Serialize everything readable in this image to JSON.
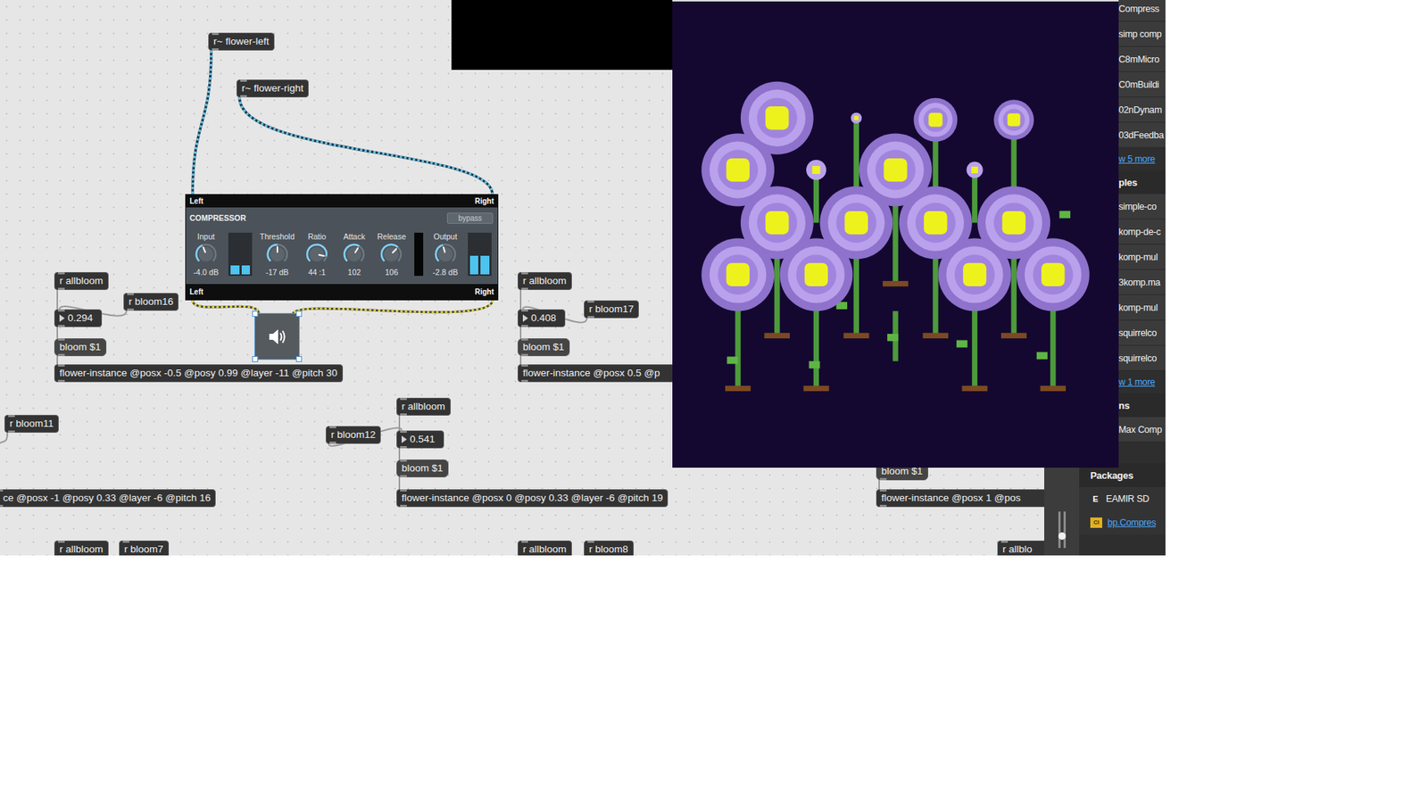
{
  "patcher": {
    "objects": [
      {
        "text": "r~ flower-left",
        "kind": "object"
      },
      {
        "text": "r~ flower-right",
        "kind": "object"
      },
      {
        "text": "r allbloom",
        "kind": "object"
      },
      {
        "text": "r bloom16",
        "kind": "object"
      },
      {
        "text": "0.294",
        "kind": "number"
      },
      {
        "text": "bloom $1",
        "kind": "message"
      },
      {
        "text": "flower-instance @posx -0.5 @posy 0.99 @layer -11 @pitch 30",
        "kind": "object"
      },
      {
        "text": "r allbloom",
        "kind": "object"
      },
      {
        "text": "r bloom17",
        "kind": "object"
      },
      {
        "text": "0.408",
        "kind": "number"
      },
      {
        "text": "bloom $1",
        "kind": "message"
      },
      {
        "text": "flower-instance @posx 0.5 @p",
        "kind": "object"
      },
      {
        "text": "r bloom11",
        "kind": "object"
      },
      {
        "text": "ce @posx -1 @posy 0.33 @layer -6 @pitch 16",
        "kind": "object"
      },
      {
        "text": "r allbloom",
        "kind": "object"
      },
      {
        "text": "r bloom12",
        "kind": "object"
      },
      {
        "text": "0.541",
        "kind": "number"
      },
      {
        "text": "bloom $1",
        "kind": "message"
      },
      {
        "text": "flower-instance @posx 0 @posy 0.33 @layer -6 @pitch 19",
        "kind": "object"
      },
      {
        "text": "bloom $1",
        "kind": "message"
      },
      {
        "text": "flower-instance @posx 1 @pos",
        "kind": "object"
      },
      {
        "text": "r allbloom",
        "kind": "object"
      },
      {
        "text": "r bloom7",
        "kind": "object"
      },
      {
        "text": "r allbloom",
        "kind": "object"
      },
      {
        "text": "r bloom8",
        "kind": "object"
      },
      {
        "text": "r allblo",
        "kind": "object"
      }
    ],
    "compressor": {
      "inlet_left": "Left",
      "inlet_right": "Right",
      "title": "COMPRESSOR",
      "bypass": {
        "label": "bypass",
        "on": false
      },
      "controls": [
        {
          "kind": "knob",
          "label": "Input",
          "value": "-4.0 dB",
          "level": 0.42
        },
        {
          "kind": "meter",
          "level": 0.22
        },
        {
          "kind": "knob",
          "label": "Threshold",
          "value": "-17 dB",
          "level": 0.5
        },
        {
          "kind": "knob",
          "label": "Ratio",
          "value": "44 :1",
          "level": 0.88
        },
        {
          "kind": "knob",
          "label": "Attack",
          "value": "102",
          "level": 0.62
        },
        {
          "kind": "knob",
          "label": "Release",
          "value": "106",
          "level": 0.66
        },
        {
          "kind": "reduction",
          "level": 0
        },
        {
          "kind": "knob",
          "label": "Output",
          "value": "-2.8 dB",
          "level": 0.44
        },
        {
          "kind": "meter",
          "level": 0.45
        }
      ],
      "outlet_left": "Left",
      "outlet_right": "Right"
    },
    "ezdac": {
      "selected": true
    }
  },
  "mixer_fader": {
    "level": 0.33
  },
  "sidebar": {
    "rows": [
      {
        "kind": "item",
        "text": "Compress"
      },
      {
        "kind": "item",
        "text": "simp comp"
      },
      {
        "kind": "item",
        "text": "C8mMicro"
      },
      {
        "kind": "item",
        "text": "C0mBuildi"
      },
      {
        "kind": "item",
        "text": "02nDynam"
      },
      {
        "kind": "item",
        "text": "03dFeedba"
      },
      {
        "kind": "link",
        "text": "w 5 more"
      },
      {
        "kind": "heading",
        "text": "ples"
      },
      {
        "kind": "item",
        "text": "simple-co"
      },
      {
        "kind": "item",
        "text": "komp-de-c"
      },
      {
        "kind": "item",
        "text": "komp-mul"
      },
      {
        "kind": "item",
        "text": "3komp.ma"
      },
      {
        "kind": "item",
        "text": "komp-mul"
      },
      {
        "kind": "item",
        "text": "squirrelco"
      },
      {
        "kind": "item",
        "text": "squirrelco"
      },
      {
        "kind": "link",
        "text": "w 1 more"
      },
      {
        "kind": "heading",
        "text": "ns"
      },
      {
        "kind": "item",
        "text": "Max Comp"
      }
    ],
    "packages": {
      "heading": "Packages",
      "items": [
        {
          "text": "EAMIR SD",
          "icon": "E",
          "link": false
        },
        {
          "text": "bp.Compres",
          "icon": "CI",
          "link": true
        }
      ]
    }
  }
}
